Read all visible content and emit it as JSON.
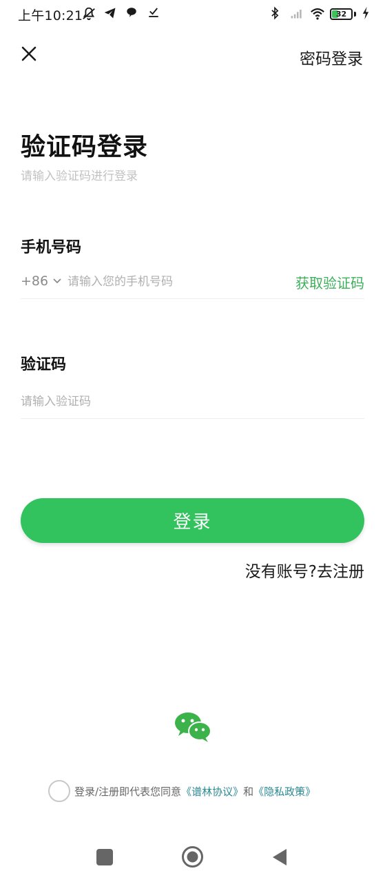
{
  "status_bar": {
    "time": "上午10:21",
    "battery_level": "32",
    "icons": [
      "mute-bell-icon",
      "telegram-icon",
      "chat-bubble-icon",
      "download-check-icon",
      "bluetooth-icon",
      "signal-icon",
      "wifi-icon",
      "battery-icon",
      "charging-bolt-icon"
    ]
  },
  "header": {
    "close_icon": "close-icon",
    "password_login_label": "密码登录"
  },
  "main": {
    "title": "验证码登录",
    "subtitle": "请输入验证码进行登录",
    "phone": {
      "label": "手机号码",
      "country_code": "+86",
      "placeholder": "请输入您的手机号码",
      "value": "",
      "get_code_label": "获取验证码"
    },
    "code": {
      "label": "验证码",
      "placeholder": "请输入验证码",
      "value": ""
    },
    "login_button_label": "登录",
    "register_link": "没有账号?去注册"
  },
  "footer": {
    "wechat_icon": "wechat-icon",
    "agreement_prefix": "登录/注册即代表您同意",
    "terms_link": "《谱林协议》",
    "conjunction": "和",
    "privacy_link": "《隐私政策》",
    "agreed": false
  },
  "nav_bar": {
    "icons": [
      "recent-apps-icon",
      "home-icon",
      "back-icon"
    ]
  },
  "colors": {
    "accent_green": "#33c35e",
    "link_teal": "#2a8a93",
    "get_code_green": "#3cb05a"
  }
}
